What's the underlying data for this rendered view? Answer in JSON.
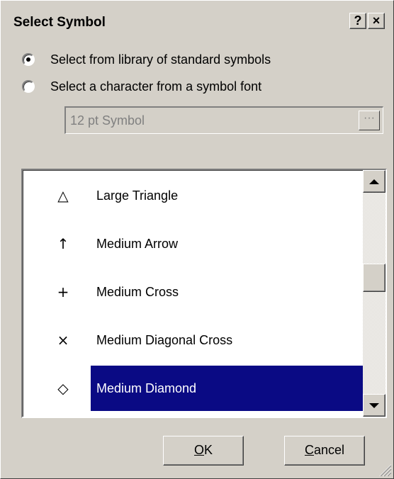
{
  "dialog": {
    "title": "Select Symbol",
    "help_button": "?",
    "close_button": "×"
  },
  "source_options": [
    {
      "label": "Select from library of standard symbols",
      "checked": true
    },
    {
      "label": "Select a character from a symbol font",
      "checked": false
    }
  ],
  "font_field": {
    "value": "12 pt Symbol",
    "browse_label": "···",
    "enabled": false
  },
  "symbol_list": {
    "items": [
      {
        "glyph": "△",
        "icon": "large-triangle-icon",
        "label": "Large Triangle",
        "selected": false
      },
      {
        "glyph": "↑",
        "icon": "medium-arrow-icon",
        "label": "Medium Arrow",
        "selected": false
      },
      {
        "glyph": "+",
        "icon": "medium-cross-icon",
        "label": "Medium Cross",
        "selected": false
      },
      {
        "glyph": "×",
        "icon": "medium-diagonal-cross-icon",
        "label": "Medium Diagonal Cross",
        "selected": false
      },
      {
        "glyph": "◇",
        "icon": "medium-diamond-icon",
        "label": "Medium Diamond",
        "selected": true
      }
    ],
    "selection_color": "#0a0a84"
  },
  "buttons": {
    "ok_mnemonic": "O",
    "ok_rest": "K",
    "cancel_mnemonic": "C",
    "cancel_rest": "ancel"
  }
}
